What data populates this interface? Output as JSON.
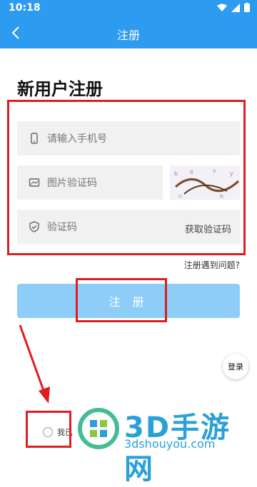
{
  "status": {
    "time": "10:18"
  },
  "appbar": {
    "title": "注册"
  },
  "heading": "新用户注册",
  "form": {
    "phone_placeholder": "请输入手机号",
    "captcha_placeholder": "图片验证码",
    "sms_placeholder": "验证码",
    "get_code_label": "获取验证码"
  },
  "help_link": "注册遇到问题?",
  "submit_label": "注 册",
  "login_label": "登录",
  "agreement_text": "我已",
  "watermark": {
    "logo_text": "3D手游网",
    "url": "3dshouyou.com"
  },
  "colors": {
    "primary": "#2d9bf0",
    "button": "#8ecdf8",
    "annotation_red": "#e11b22",
    "field_bg": "#f1f1f1"
  }
}
